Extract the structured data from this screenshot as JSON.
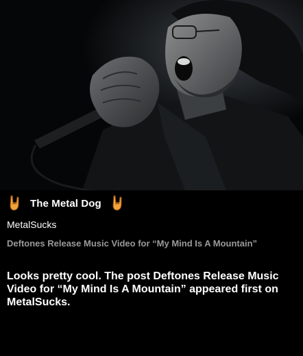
{
  "hero": {
    "image_subject": "singer-with-microphone-photo"
  },
  "brand": {
    "name": "The Metal Dog",
    "icon": "rock-horns-icon",
    "icon_color": "#f2a23a"
  },
  "article": {
    "source": "MetalSucks",
    "headline": "Deftones Release Music Video for “My Mind Is A Mountain”",
    "summary": "Looks pretty cool. The post Deftones Release Music Video for “My Mind Is A Mountain” appeared first on MetalSucks."
  },
  "colors": {
    "background": "#000000",
    "headline": "#9a9a9a",
    "text": "#ffffff"
  }
}
